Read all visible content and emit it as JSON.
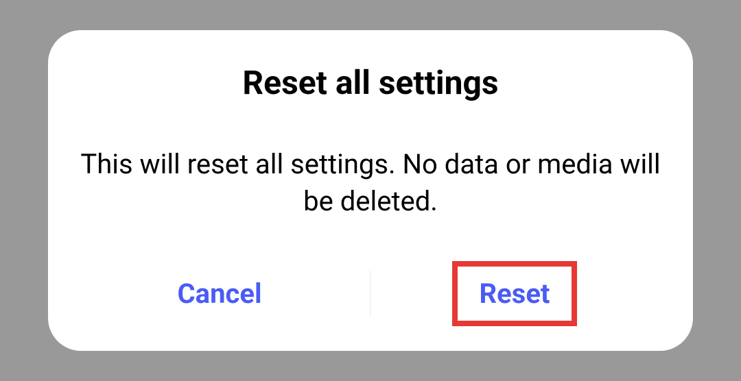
{
  "dialog": {
    "title": "Reset all settings",
    "message": "This will reset all settings. No data or media will be deleted.",
    "cancel_label": "Cancel",
    "reset_label": "Reset"
  }
}
